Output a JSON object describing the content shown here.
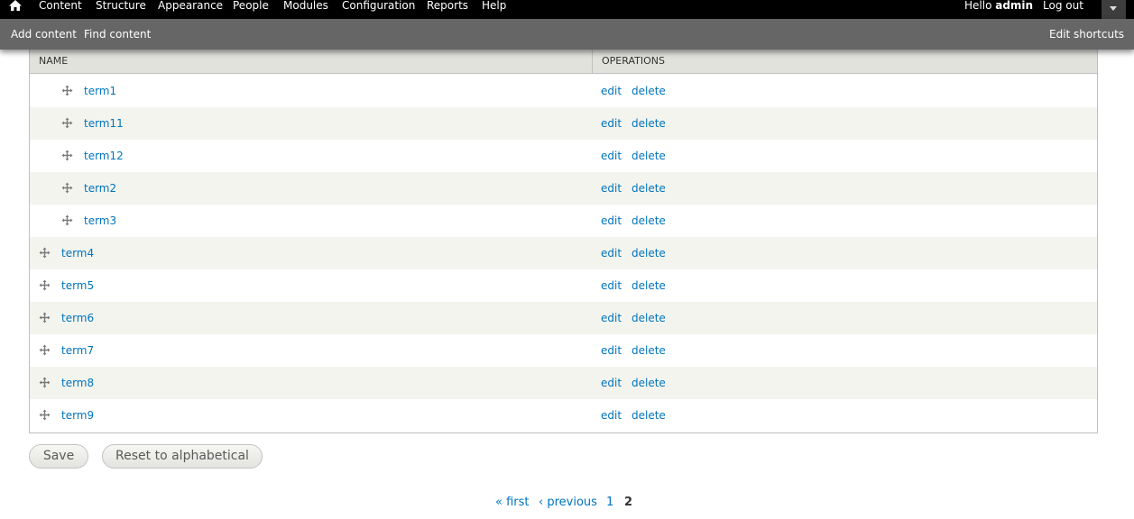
{
  "toolbar": {
    "menu": [
      "Content",
      "Structure",
      "Appearance",
      "People",
      "Modules",
      "Configuration",
      "Reports",
      "Help"
    ],
    "hello_prefix": "Hello ",
    "username": "admin",
    "logout": "Log out"
  },
  "shortcuts": {
    "items": [
      "Add content",
      "Find content"
    ],
    "edit": "Edit shortcuts"
  },
  "table": {
    "headers": {
      "name": "NAME",
      "operations": "OPERATIONS"
    },
    "rows": [
      {
        "term": "term1",
        "edit": "edit",
        "delete": "delete"
      },
      {
        "term": "term11",
        "edit": "edit",
        "delete": "delete"
      },
      {
        "term": "term12",
        "edit": "edit",
        "delete": "delete"
      },
      {
        "term": "term2",
        "edit": "edit",
        "delete": "delete"
      },
      {
        "term": "term3",
        "edit": "edit",
        "delete": "delete"
      },
      {
        "term": "term4",
        "edit": "edit",
        "delete": "delete"
      },
      {
        "term": "term5",
        "edit": "edit",
        "delete": "delete"
      },
      {
        "term": "term6",
        "edit": "edit",
        "delete": "delete"
      },
      {
        "term": "term7",
        "edit": "edit",
        "delete": "delete"
      },
      {
        "term": "term8",
        "edit": "edit",
        "delete": "delete"
      },
      {
        "term": "term9",
        "edit": "edit",
        "delete": "delete"
      }
    ]
  },
  "buttons": {
    "save": "Save",
    "reset": "Reset to alphabetical"
  },
  "pager": {
    "first": "« first",
    "previous": "‹ previous",
    "page1": "1",
    "page2": "2"
  },
  "colors": {
    "link": "#0074bd",
    "toolbar": "#000000",
    "shortcuts_bar": "#666666"
  },
  "icons": {
    "home": "home-icon",
    "drag": "drag-handle-icon",
    "tray": "chevron-down-icon"
  }
}
